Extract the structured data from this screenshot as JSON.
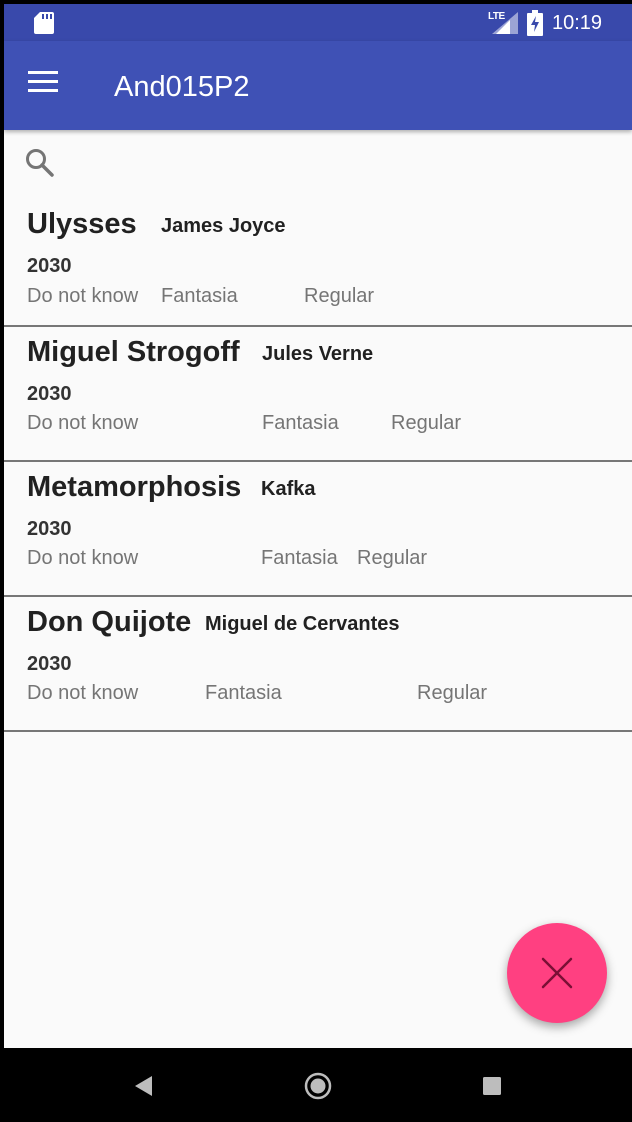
{
  "status_bar": {
    "time": "10:19",
    "network": "LTE",
    "icons": [
      "sd-card-icon",
      "signal-icon",
      "battery-charging-icon"
    ]
  },
  "app_bar": {
    "title": "And015P2",
    "menu_icon": "menu-icon"
  },
  "search": {
    "icon": "search-icon"
  },
  "books": [
    {
      "title": "Ulysses",
      "author": "James Joyce",
      "year": "2030",
      "status": "Do not know",
      "genre": "Fantasia",
      "rating": "Regular"
    },
    {
      "title": "Miguel Strogoff",
      "author": "Jules Verne",
      "year": "2030",
      "status": "Do not know",
      "genre": "Fantasia",
      "rating": "Regular"
    },
    {
      "title": "Metamorphosis",
      "author": "Kafka",
      "year": "2030",
      "status": "Do not know",
      "genre": "Fantasia",
      "rating": "Regular"
    },
    {
      "title": "Don Quijote",
      "author": "Miguel de Cervantes",
      "year": "2030",
      "status": "Do not know",
      "genre": "Fantasia",
      "rating": "Regular"
    }
  ],
  "fab": {
    "icon": "close-icon",
    "color": "#ff4081"
  },
  "nav_bar": {
    "icons": [
      "back-icon",
      "home-icon",
      "recents-icon"
    ]
  },
  "colors": {
    "app_bar": "#3f51b5",
    "status_bar": "#3949ab",
    "accent": "#ff4081"
  }
}
